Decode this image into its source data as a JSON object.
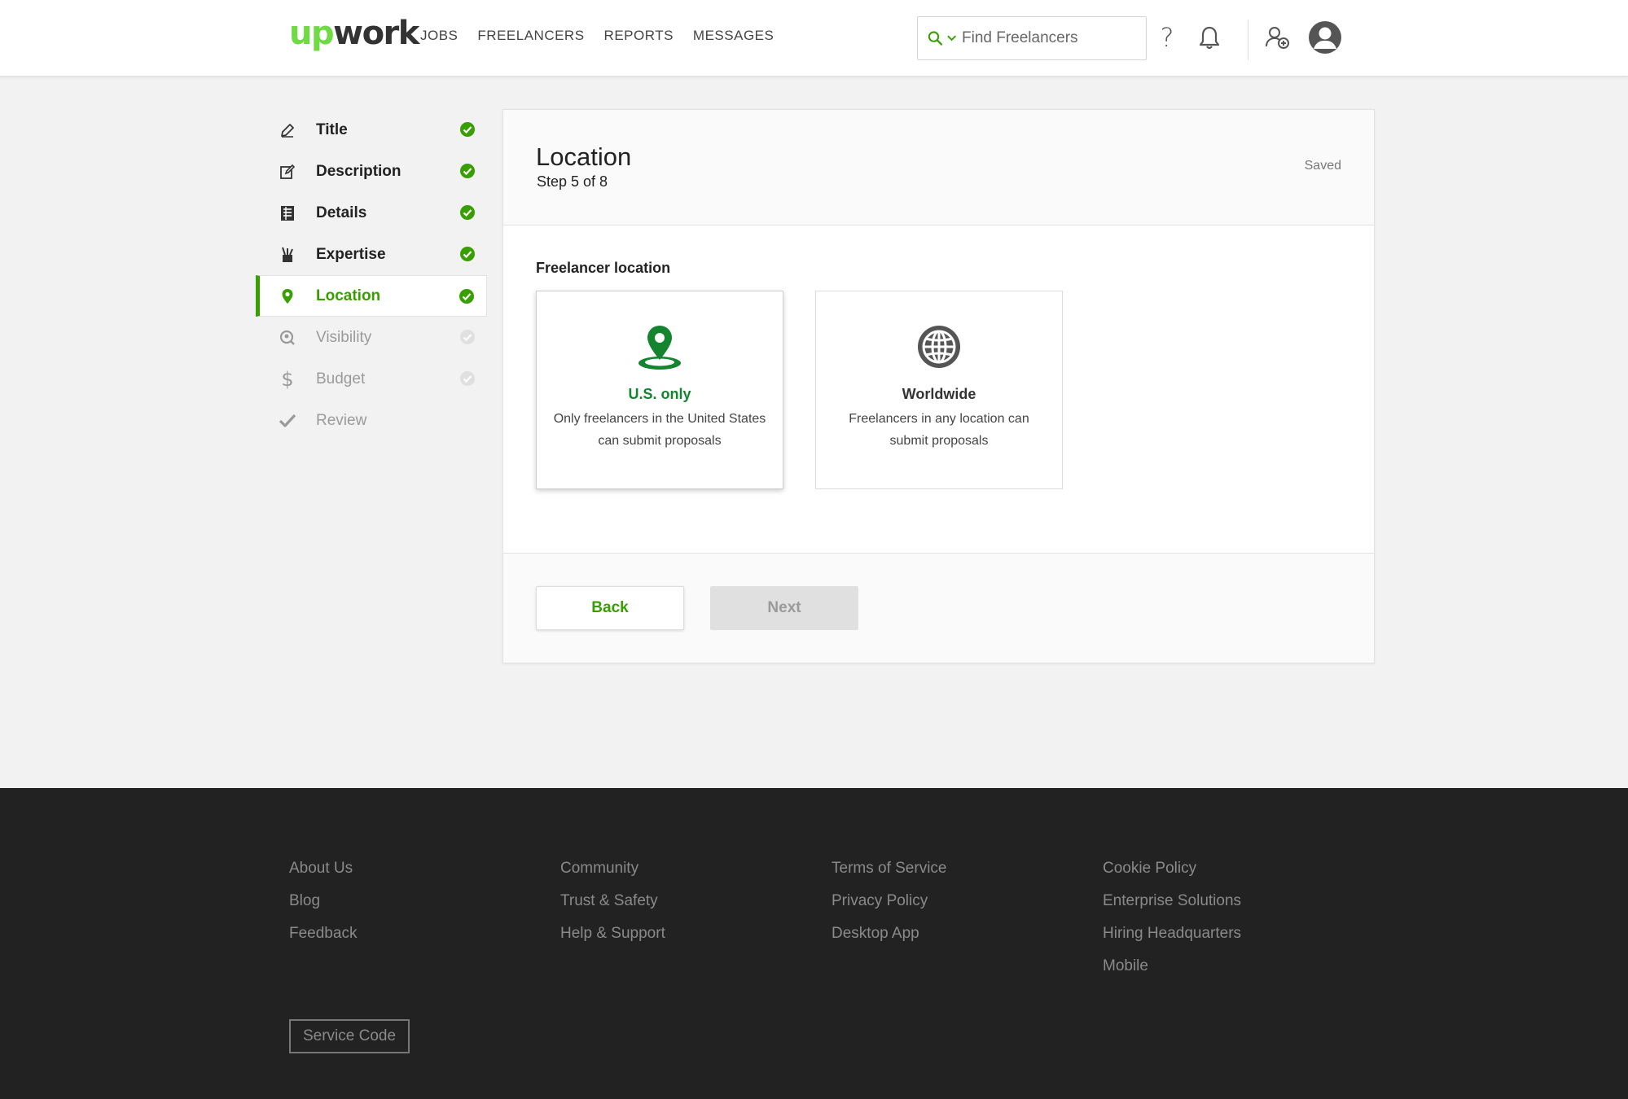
{
  "header": {
    "logo_up": "up",
    "logo_work": "work",
    "nav": [
      "JOBS",
      "FREELANCERS",
      "REPORTS",
      "MESSAGES"
    ],
    "search_placeholder": "Find Freelancers",
    "help_glyph": "?",
    "icons": [
      "search-icon",
      "chevron-down-icon",
      "help-icon",
      "bell-icon",
      "add-user-icon",
      "avatar-icon"
    ]
  },
  "sidebar": {
    "items": [
      {
        "label": "Title",
        "icon": "pencil-icon",
        "state": "done"
      },
      {
        "label": "Description",
        "icon": "edit-icon",
        "state": "done"
      },
      {
        "label": "Details",
        "icon": "list-icon",
        "state": "done"
      },
      {
        "label": "Expertise",
        "icon": "tools-icon",
        "state": "done"
      },
      {
        "label": "Location",
        "icon": "location-pin-icon",
        "state": "active"
      },
      {
        "label": "Visibility",
        "icon": "visibility-icon",
        "state": "pending"
      },
      {
        "label": "Budget",
        "icon": "dollar-icon",
        "state": "pending"
      },
      {
        "label": "Review",
        "icon": "checkmark-icon",
        "state": "pending"
      }
    ]
  },
  "card": {
    "title": "Location",
    "step": "Step 5 of 8",
    "saved": "Saved",
    "section_label": "Freelancer location",
    "options": [
      {
        "title": "U.S. only",
        "desc": "Only freelancers in the United States can submit proposals",
        "icon": "location-pin-icon",
        "selected": true
      },
      {
        "title": "Worldwide",
        "desc": "Freelancers in any location can submit proposals",
        "icon": "globe-icon",
        "selected": false
      }
    ],
    "back_label": "Back",
    "next_label": "Next"
  },
  "footer": {
    "columns": [
      [
        "About Us",
        "Blog",
        "Feedback"
      ],
      [
        "Community",
        "Trust & Safety",
        "Help & Support"
      ],
      [
        "Terms of Service",
        "Privacy Policy",
        "Desktop App"
      ],
      [
        "Cookie Policy",
        "Enterprise Solutions",
        "Hiring Headquarters",
        "Mobile"
      ]
    ],
    "service_code": "Service Code"
  },
  "colors": {
    "brand_green": "#6fda44",
    "active_green": "#37a000",
    "selected_green": "#14852e",
    "footer_bg": "#222222"
  }
}
